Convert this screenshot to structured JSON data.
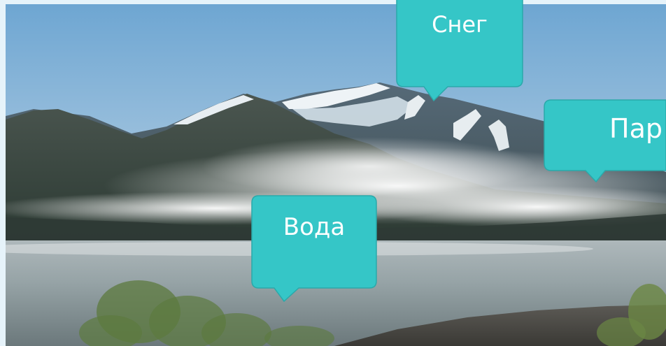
{
  "scene": {
    "description_icon": "mountain-lake-photo-icon"
  },
  "callouts": {
    "snow": {
      "label": "Снег"
    },
    "steam": {
      "label": "Пар"
    },
    "water": {
      "label": "Вода"
    }
  },
  "colors": {
    "callout_fill": "#35c6c7",
    "callout_stroke": "#2aa9aa",
    "sky_top": "#7fb1d6",
    "sky_bottom": "#c9dcea",
    "lake": "#8fa0a6",
    "frame": "#e6f3fa"
  }
}
